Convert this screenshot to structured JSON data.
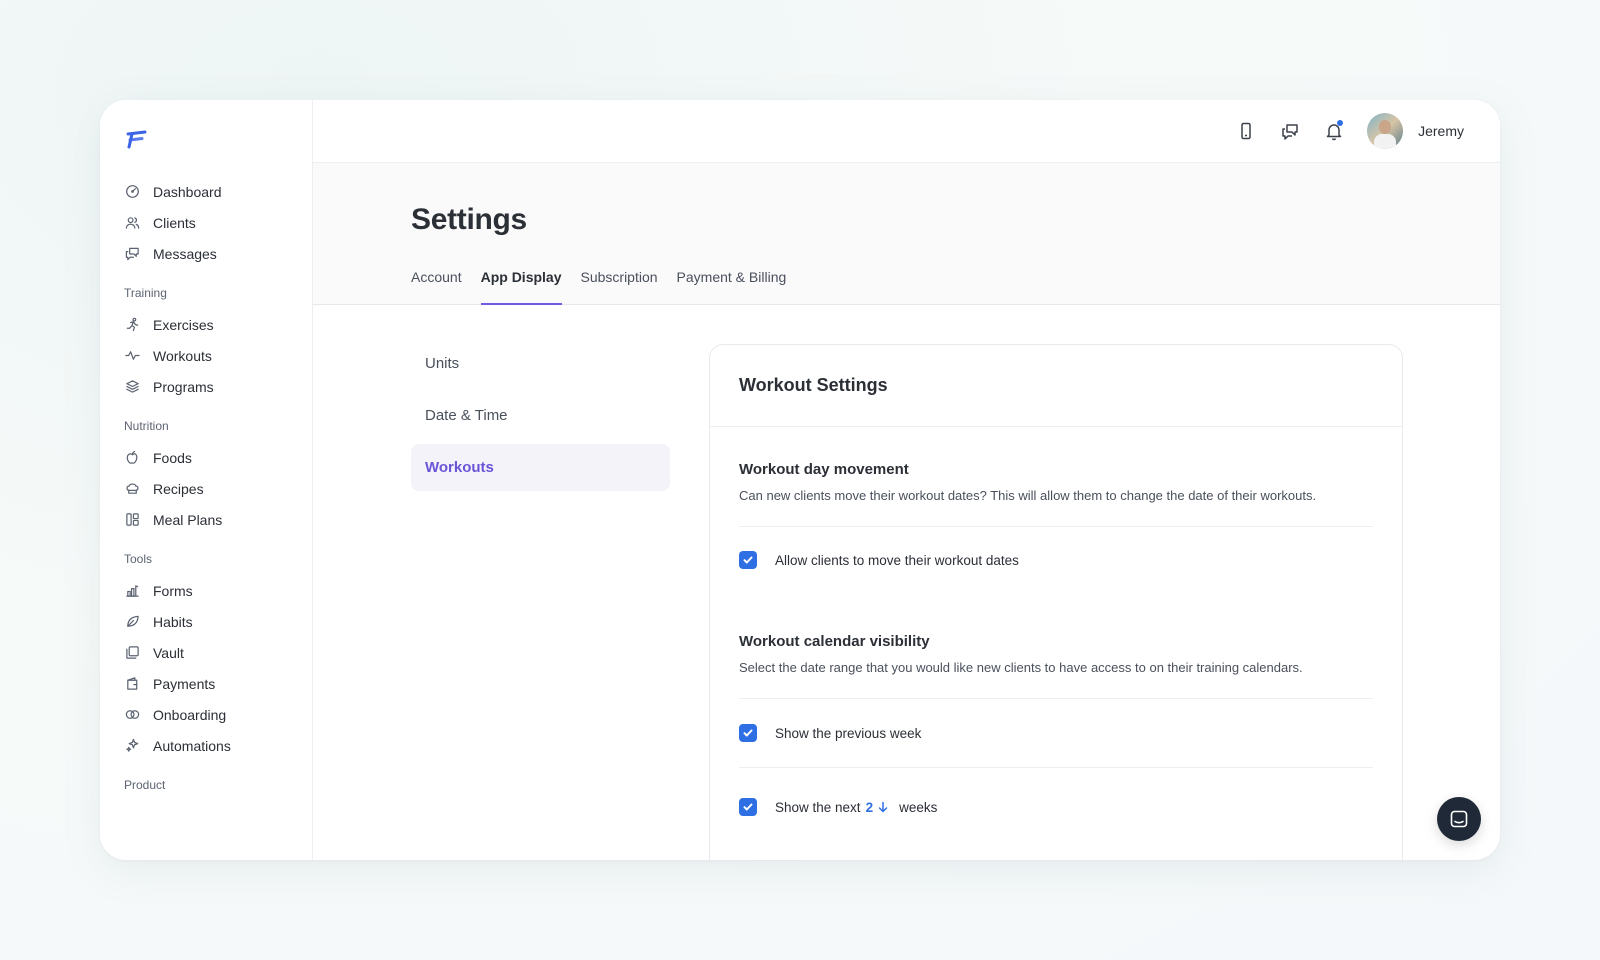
{
  "sidebar": {
    "top_items": [
      {
        "label": "Dashboard",
        "icon": "dashboard-icon"
      },
      {
        "label": "Clients",
        "icon": "users-icon"
      },
      {
        "label": "Messages",
        "icon": "messages-icon"
      }
    ],
    "sections": [
      {
        "title": "Training",
        "items": [
          {
            "label": "Exercises",
            "icon": "running-icon"
          },
          {
            "label": "Workouts",
            "icon": "pulse-icon"
          },
          {
            "label": "Programs",
            "icon": "layers-icon"
          }
        ]
      },
      {
        "title": "Nutrition",
        "items": [
          {
            "label": "Foods",
            "icon": "apple-icon"
          },
          {
            "label": "Recipes",
            "icon": "chef-hat-icon"
          },
          {
            "label": "Meal Plans",
            "icon": "grid-icon"
          }
        ]
      },
      {
        "title": "Tools",
        "items": [
          {
            "label": "Forms",
            "icon": "forms-icon"
          },
          {
            "label": "Habits",
            "icon": "leaf-icon"
          },
          {
            "label": "Vault",
            "icon": "vault-icon"
          },
          {
            "label": "Payments",
            "icon": "wallet-icon"
          },
          {
            "label": "Onboarding",
            "icon": "rings-icon"
          },
          {
            "label": "Automations",
            "icon": "sparkles-icon"
          }
        ]
      },
      {
        "title": "Product",
        "items": []
      }
    ]
  },
  "header": {
    "username": "Jeremy"
  },
  "page": {
    "title": "Settings",
    "tabs": [
      {
        "label": "Account"
      },
      {
        "label": "App Display"
      },
      {
        "label": "Subscription"
      },
      {
        "label": "Payment & Billing"
      }
    ],
    "active_tab": "App Display"
  },
  "submenu": {
    "items": [
      {
        "label": "Units"
      },
      {
        "label": "Date & Time"
      },
      {
        "label": "Workouts"
      }
    ],
    "active": "Workouts"
  },
  "card": {
    "title": "Workout Settings",
    "movement": {
      "title": "Workout day movement",
      "description": "Can new clients move their workout dates? This will allow them to change the date of their workouts.",
      "checkbox_label": "Allow clients to move their workout dates",
      "checked": true
    },
    "visibility": {
      "title": "Workout calendar visibility",
      "description": "Select the date range that you would like new clients to have access to on their training calendars.",
      "previous_label": "Show the previous week",
      "previous_checked": true,
      "next_prefix": "Show the next",
      "next_value": "2",
      "next_suffix": "weeks",
      "next_checked": true
    }
  },
  "colors": {
    "accent": "#6c5ce7",
    "checkbox": "#2f6fe4",
    "chat_button": "#1f2937"
  }
}
